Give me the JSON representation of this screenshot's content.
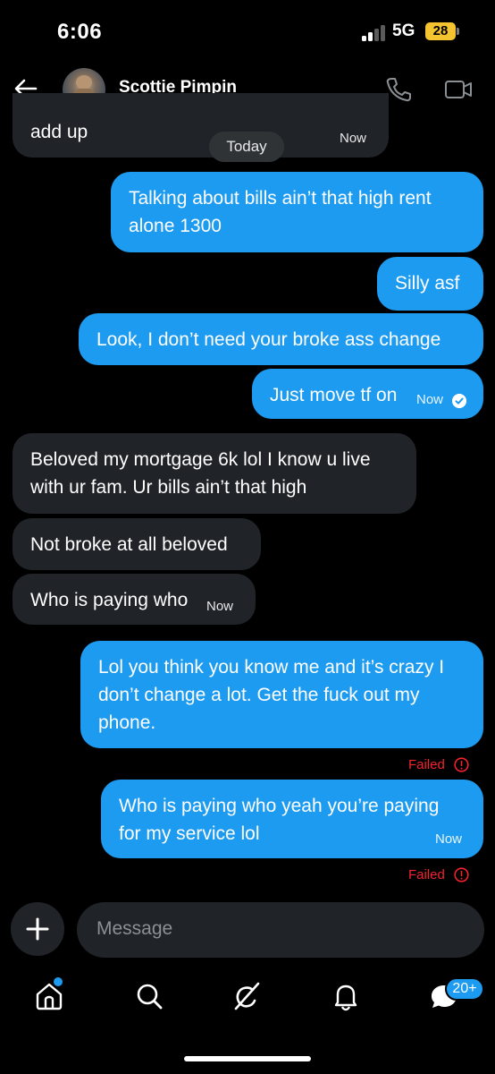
{
  "status_bar": {
    "time": "6:06",
    "network": "5G",
    "battery": "28"
  },
  "header": {
    "contact_name": "Scottie Pimpin"
  },
  "date_divider": "Today",
  "messages": [
    {
      "direction": "in",
      "text": "add up",
      "time": "Now"
    },
    {
      "direction": "out",
      "text": "Talking about bills ain’t that high rent alone 1300"
    },
    {
      "direction": "out",
      "text": "Silly asf"
    },
    {
      "direction": "out",
      "text": "Look, I don’t need your broke ass change"
    },
    {
      "direction": "out",
      "text": "Just move tf on",
      "time": "Now",
      "status": "read"
    },
    {
      "direction": "in",
      "text": "Beloved my mortgage 6k lol I know u live with ur fam. Ur bills ain’t that high"
    },
    {
      "direction": "in",
      "text": "Not broke at all beloved"
    },
    {
      "direction": "in",
      "text": "Who is paying who",
      "time": "Now"
    },
    {
      "direction": "out",
      "text": "Lol you think you know me and it’s crazy I don’t change a lot. Get the fuck out my phone.",
      "status": "Failed"
    },
    {
      "direction": "out",
      "text": "Who is paying who yeah you’re paying for my service lol",
      "time": "Now",
      "status": "Failed"
    }
  ],
  "composer": {
    "placeholder": "Message"
  },
  "nav": {
    "items": [
      "home-icon",
      "search-icon",
      "grok-icon",
      "notifications-icon",
      "messages-icon"
    ],
    "messages_badge": "20+"
  },
  "colors": {
    "accent": "#1d9bf0",
    "incoming_bubble": "#202327",
    "error": "#f4212e",
    "background": "#000000"
  }
}
